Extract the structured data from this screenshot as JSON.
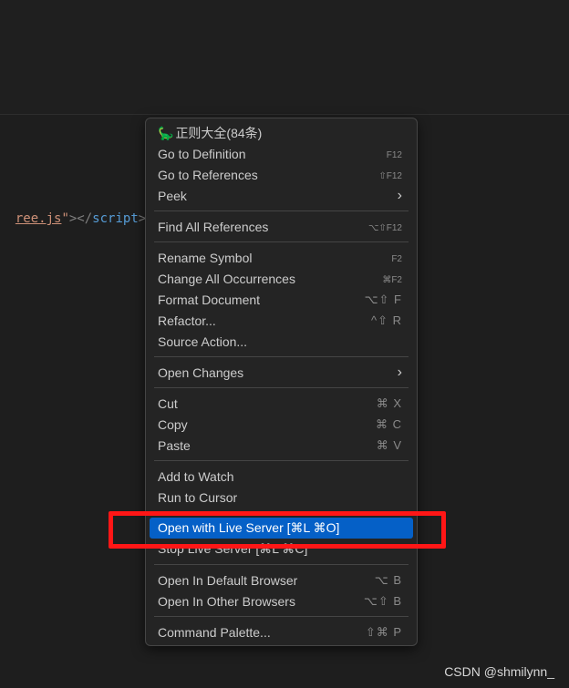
{
  "code": {
    "filename_fragment": "ree.js",
    "quote": "\"",
    "tag_open": "></",
    "tag_name": "script",
    "tag_close": ">"
  },
  "menu": {
    "items": [
      {
        "label": "正则大全(84条)",
        "shortcut": "",
        "submenu": false,
        "icon": "dinosaur-icon"
      },
      {
        "label": "Go to Definition",
        "shortcut": "F12",
        "submenu": false
      },
      {
        "label": "Go to References",
        "shortcut": "⇧F12",
        "submenu": false
      },
      {
        "label": "Peek",
        "shortcut": "",
        "submenu": true
      },
      {
        "label": "Find All References",
        "shortcut": "⌥⇧F12",
        "submenu": false
      },
      {
        "label": "Rename Symbol",
        "shortcut": "F2",
        "submenu": false
      },
      {
        "label": "Change All Occurrences",
        "shortcut": "⌘F2",
        "submenu": false
      },
      {
        "label": "Format Document",
        "shortcut": "⌥⇧ F",
        "submenu": false
      },
      {
        "label": "Refactor...",
        "shortcut": "^⇧ R",
        "submenu": false
      },
      {
        "label": "Source Action...",
        "shortcut": "",
        "submenu": false
      },
      {
        "label": "Open Changes",
        "shortcut": "",
        "submenu": true
      },
      {
        "label": "Cut",
        "shortcut": "⌘ X",
        "submenu": false
      },
      {
        "label": "Copy",
        "shortcut": "⌘ C",
        "submenu": false
      },
      {
        "label": "Paste",
        "shortcut": "⌘ V",
        "submenu": false
      },
      {
        "label": "Add to Watch",
        "shortcut": "",
        "submenu": false
      },
      {
        "label": "Run to Cursor",
        "shortcut": "",
        "submenu": false
      },
      {
        "label": "Open with Live Server [⌘L ⌘O]",
        "shortcut": "",
        "submenu": false,
        "highlighted": true
      },
      {
        "label": "Stop Live Server [⌘L ⌘C]",
        "shortcut": "",
        "submenu": false
      },
      {
        "label": "Open In Default Browser",
        "shortcut": "⌥ B",
        "submenu": false
      },
      {
        "label": "Open In Other Browsers",
        "shortcut": "⌥⇧ B",
        "submenu": false
      },
      {
        "label": "Command Palette...",
        "shortcut": "⇧⌘ P",
        "submenu": false
      }
    ],
    "chevron_glyph": "›",
    "dino_glyph": "🦕"
  },
  "watermark": "CSDN @shmilynn_",
  "colors": {
    "highlight": "#0560c7",
    "annotation_box": "#ff1616"
  }
}
